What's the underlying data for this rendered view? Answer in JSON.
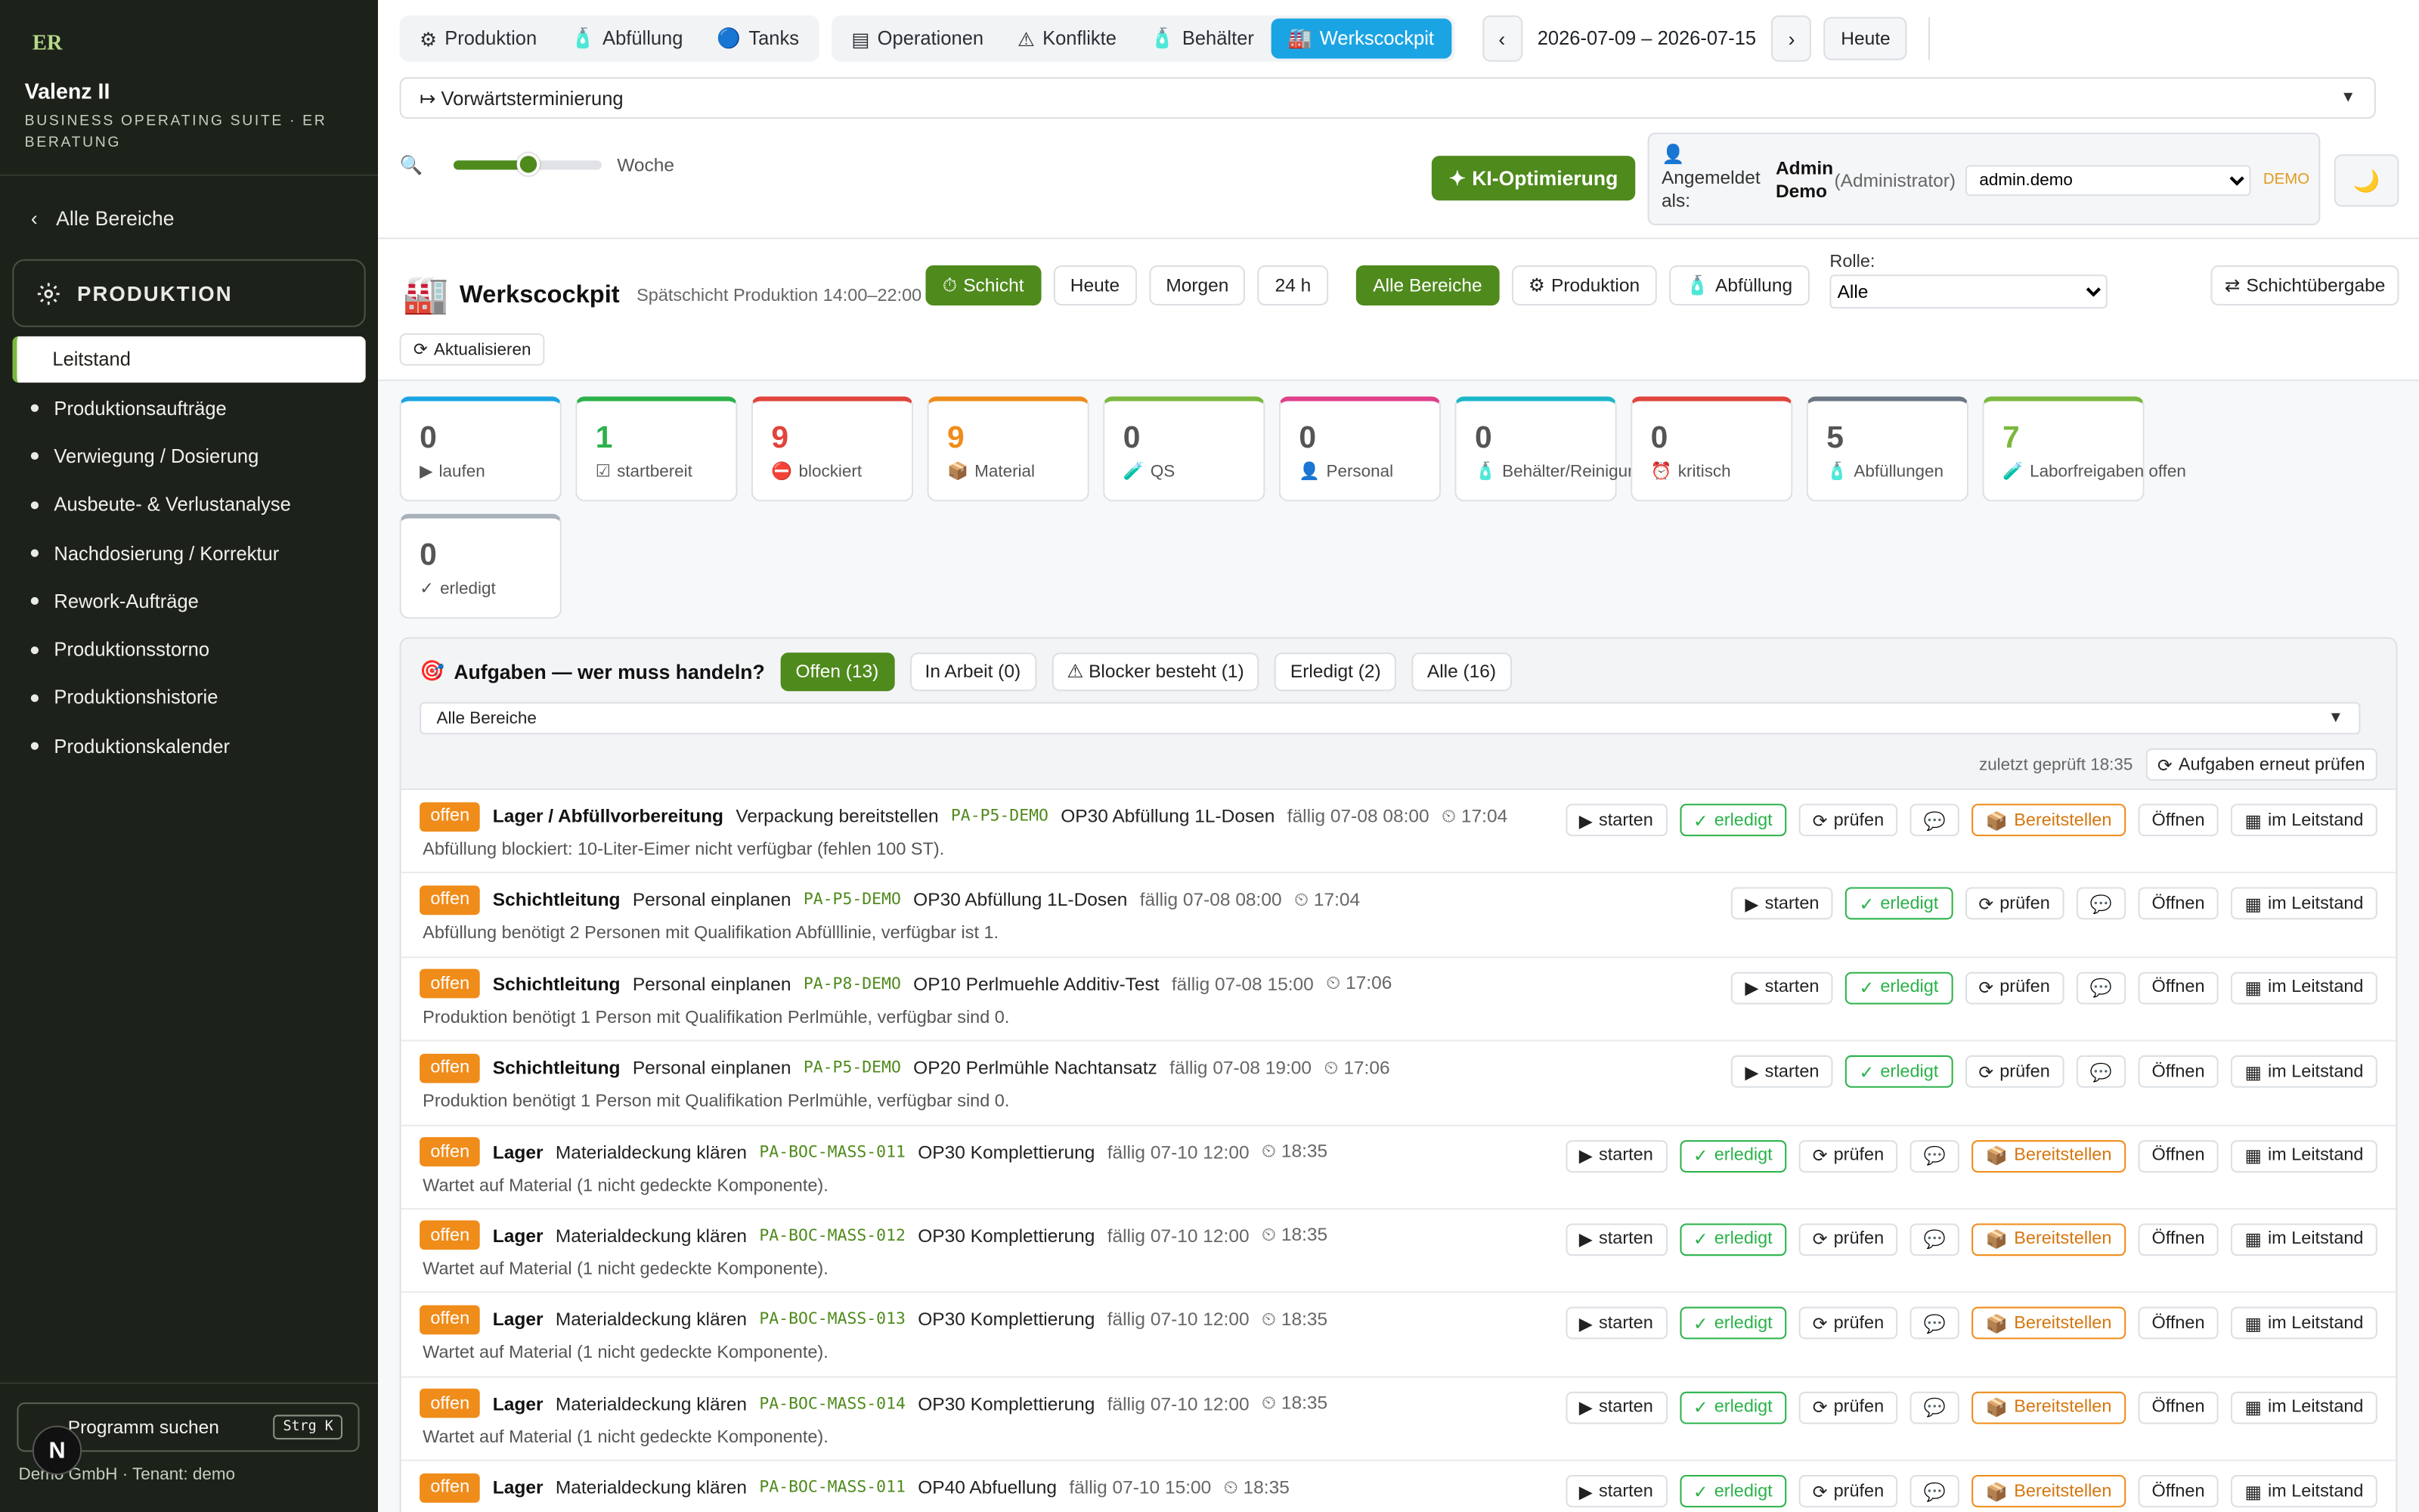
{
  "app": {
    "logo": "ER",
    "title": "Valenz II",
    "subtitle": "BUSINESS OPERATING SUITE · ER BERATUNG"
  },
  "sidebar": {
    "back_label": "Alle Bereiche",
    "section": "PRODUKTION",
    "items": [
      {
        "label": "Leitstand",
        "active": true
      },
      {
        "label": "Produktionsaufträge"
      },
      {
        "label": "Verwiegung / Dosierung"
      },
      {
        "label": "Ausbeute- & Verlustanalyse"
      },
      {
        "label": "Nachdosierung / Korrektur"
      },
      {
        "label": "Rework-Aufträge"
      },
      {
        "label": "Produktionsstorno"
      },
      {
        "label": "Produktionshistorie"
      },
      {
        "label": "Produktionskalender"
      }
    ],
    "search_label": "Programm suchen",
    "search_kbd": "Strg K",
    "tenant": "Demo GmbH · Tenant: demo",
    "badge": "N"
  },
  "toolbar": {
    "tabs": [
      {
        "label": "Produktion",
        "icon": "gear-icon"
      },
      {
        "label": "Abfüllung",
        "icon": "bottle-icon"
      },
      {
        "label": "Tanks",
        "icon": "circle-icon"
      },
      {
        "label": "Operationen",
        "icon": "list-icon"
      },
      {
        "label": "Konflikte",
        "icon": "warning-icon"
      },
      {
        "label": "Behälter",
        "icon": "bottle-icon"
      },
      {
        "label": "Werkscockpit",
        "icon": "factory-icon",
        "active": true
      }
    ],
    "date_range": "2026-07-09 – 2026-07-15",
    "today": "Heute",
    "scheduling": "↦ Vorwärtsterminierung",
    "zoom_label": "Woche",
    "zoom_level": 0.5,
    "ki_label": "KI-Optimierung",
    "user": {
      "logged_in_as": "Angemeldet als:",
      "name": "Admin Demo",
      "role": "(Administrator)",
      "account": "admin.demo",
      "demo": "DEMO"
    }
  },
  "cockpit": {
    "title": "Werkscockpit",
    "subtitle": "Spätschicht Produktion 14:00–22:00",
    "time_chips": [
      "Schicht",
      "Heute",
      "Morgen",
      "24 h"
    ],
    "area_chips": [
      "Alle Bereiche",
      "Produktion",
      "Abfüllung"
    ],
    "role_label": "Rolle:",
    "role_value": "Alle",
    "handover": "Schichtübergabe",
    "refresh": "Aktualisieren"
  },
  "kpis": [
    {
      "value": "0",
      "label": "laufen",
      "icon": "▶",
      "color": "#1ba4e3",
      "vcolor": "#555"
    },
    {
      "value": "1",
      "label": "startbereit",
      "icon": "☑",
      "color": "#2bb24a",
      "vcolor": "#2bb24a"
    },
    {
      "value": "9",
      "label": "blockiert",
      "icon": "⛔",
      "color": "#e0443c",
      "vcolor": "#e0443c"
    },
    {
      "value": "9",
      "label": "Material",
      "icon": "📦",
      "color": "#f08c1a",
      "vcolor": "#f08c1a"
    },
    {
      "value": "0",
      "label": "QS",
      "icon": "🧪",
      "color": "#7ab83e",
      "vcolor": "#555"
    },
    {
      "value": "0",
      "label": "Personal",
      "icon": "👤",
      "color": "#e0408a",
      "vcolor": "#555"
    },
    {
      "value": "0",
      "label": "Behälter/Reinigung",
      "icon": "🧴",
      "color": "#1bb7c9",
      "vcolor": "#555"
    },
    {
      "value": "0",
      "label": "kritisch",
      "icon": "⏰",
      "color": "#e0443c",
      "vcolor": "#555"
    },
    {
      "value": "5",
      "label": "Abfüllungen",
      "icon": "🧴",
      "color": "#6b7785",
      "vcolor": "#555"
    },
    {
      "value": "7",
      "label": "Laborfreigaben offen",
      "icon": "🧪",
      "color": "#7ab83e",
      "vcolor": "#7ab83e"
    },
    {
      "value": "0",
      "label": "erledigt",
      "icon": "✓",
      "color": "#a9b1bb",
      "vcolor": "#555"
    }
  ],
  "tasks": {
    "title": "Aufgaben — wer muss handeln?",
    "filters": [
      {
        "label": "Offen (13)",
        "active": true
      },
      {
        "label": "In Arbeit (0)"
      },
      {
        "label": "⚠ Blocker besteht (1)"
      },
      {
        "label": "Erledigt (2)"
      },
      {
        "label": "Alle (16)"
      }
    ],
    "area_select": "Alle Bereiche",
    "last_checked": "zuletzt geprüft 18:35",
    "recheck": "Aufgaben erneut prüfen",
    "actions": {
      "start": "starten",
      "done": "erledigt",
      "check": "prüfen",
      "provide": "Bereitstellen",
      "open": "Öffnen",
      "leitstand": "im Leitstand"
    },
    "rows": [
      {
        "status": "offen",
        "area": "Lager / Abfüllvorbereitung",
        "task": "Verpackung bereitstellen",
        "code": "PA-P5-DEMO",
        "op": "OP30 Abfüllung 1L-Dosen",
        "due": "fällig 07-08 08:00",
        "time": "17:04",
        "desc": "Abfüllung blockiert: 10-Liter-Eimer nicht verfügbar (fehlen 100 ST).",
        "provide": true
      },
      {
        "status": "offen",
        "area": "Schichtleitung",
        "task": "Personal einplanen",
        "code": "PA-P5-DEMO",
        "op": "OP30 Abfüllung 1L-Dosen",
        "due": "fällig 07-08 08:00",
        "time": "17:04",
        "desc": "Abfüllung benötigt 2 Personen mit Qualifikation Abfülllinie, verfügbar ist 1.",
        "provide": false
      },
      {
        "status": "offen",
        "area": "Schichtleitung",
        "task": "Personal einplanen",
        "code": "PA-P8-DEMO",
        "op": "OP10 Perlmuehle Additiv-Test",
        "due": "fällig 07-08 15:00",
        "time": "17:06",
        "desc": "Produktion benötigt 1 Person mit Qualifikation Perlmühle, verfügbar sind 0.",
        "provide": false
      },
      {
        "status": "offen",
        "area": "Schichtleitung",
        "task": "Personal einplanen",
        "code": "PA-P5-DEMO",
        "op": "OP20 Perlmühle Nachtansatz",
        "due": "fällig 07-08 19:00",
        "time": "17:06",
        "desc": "Produktion benötigt 1 Person mit Qualifikation Perlmühle, verfügbar sind 0.",
        "provide": false
      },
      {
        "status": "offen",
        "area": "Lager",
        "task": "Materialdeckung klären",
        "code": "PA-BOC-MASS-011",
        "op": "OP30 Komplettierung",
        "due": "fällig 07-10 12:00",
        "time": "18:35",
        "desc": "Wartet auf Material (1 nicht gedeckte Komponente).",
        "provide": true
      },
      {
        "status": "offen",
        "area": "Lager",
        "task": "Materialdeckung klären",
        "code": "PA-BOC-MASS-012",
        "op": "OP30 Komplettierung",
        "due": "fällig 07-10 12:00",
        "time": "18:35",
        "desc": "Wartet auf Material (1 nicht gedeckte Komponente).",
        "provide": true
      },
      {
        "status": "offen",
        "area": "Lager",
        "task": "Materialdeckung klären",
        "code": "PA-BOC-MASS-013",
        "op": "OP30 Komplettierung",
        "due": "fällig 07-10 12:00",
        "time": "18:35",
        "desc": "Wartet auf Material (1 nicht gedeckte Komponente).",
        "provide": true
      },
      {
        "status": "offen",
        "area": "Lager",
        "task": "Materialdeckung klären",
        "code": "PA-BOC-MASS-014",
        "op": "OP30 Komplettierung",
        "due": "fällig 07-10 12:00",
        "time": "18:35",
        "desc": "Wartet auf Material (1 nicht gedeckte Komponente).",
        "provide": true
      },
      {
        "status": "offen",
        "area": "Lager",
        "task": "Materialdeckung klären",
        "code": "PA-BOC-MASS-011",
        "op": "OP40 Abfuellung",
        "due": "fällig 07-10 15:00",
        "time": "18:35",
        "desc": "",
        "provide": true
      }
    ]
  }
}
